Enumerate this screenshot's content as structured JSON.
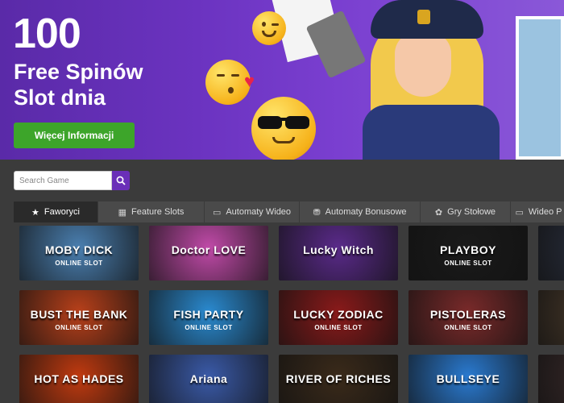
{
  "hero": {
    "number": "100",
    "line1": "Free Spinów",
    "line2": "Slot dnia",
    "button_label": "Więcej Informacji"
  },
  "search": {
    "placeholder": "Search Game"
  },
  "tabs": [
    {
      "label": "Faworyci",
      "icon": "star-icon",
      "active": true
    },
    {
      "label": "Feature Slots",
      "icon": "calendar-icon",
      "active": false
    },
    {
      "label": "Automaty Wideo",
      "icon": "monitor-icon",
      "active": false
    },
    {
      "label": "Automaty Bonusowe",
      "icon": "coins-icon",
      "active": false
    },
    {
      "label": "Gry Stołowe",
      "icon": "chips-icon",
      "active": false
    },
    {
      "label": "Wideo P",
      "icon": "monitor-icon",
      "active": false
    }
  ],
  "games": [
    {
      "title": "MOBY DICK",
      "subtitle": "ONLINE SLOT",
      "bg": "#4a7fb0"
    },
    {
      "title": "Doctor LOVE",
      "subtitle": "",
      "bg": "#c04aa8"
    },
    {
      "title": "Lucky Witch",
      "subtitle": "",
      "bg": "#5a2a8a"
    },
    {
      "title": "PLAYBOY",
      "subtitle": "ONLINE SLOT",
      "bg": "#1a1a1a"
    },
    {
      "title": "",
      "subtitle": "",
      "bg": "#2a3040"
    },
    {
      "title": "BUST THE BANK",
      "subtitle": "ONLINE SLOT",
      "bg": "#b8401a"
    },
    {
      "title": "FISH PARTY",
      "subtitle": "ONLINE SLOT",
      "bg": "#2a8ad0"
    },
    {
      "title": "LUCKY ZODIAC",
      "subtitle": "ONLINE SLOT",
      "bg": "#8a1a1a"
    },
    {
      "title": "PISTOLERAS",
      "subtitle": "ONLINE SLOT",
      "bg": "#7a2a2a"
    },
    {
      "title": "",
      "subtitle": "",
      "bg": "#4a3a2a"
    },
    {
      "title": "HOT AS HADES",
      "subtitle": "",
      "bg": "#c03a10"
    },
    {
      "title": "Ariana",
      "subtitle": "",
      "bg": "#3a5aa8"
    },
    {
      "title": "RIVER OF RICHES",
      "subtitle": "",
      "bg": "#3a2a1a"
    },
    {
      "title": "BULLSEYE",
      "subtitle": "",
      "bg": "#2a7ad0"
    },
    {
      "title": "",
      "subtitle": "",
      "bg": "#3a2a2a"
    }
  ]
}
